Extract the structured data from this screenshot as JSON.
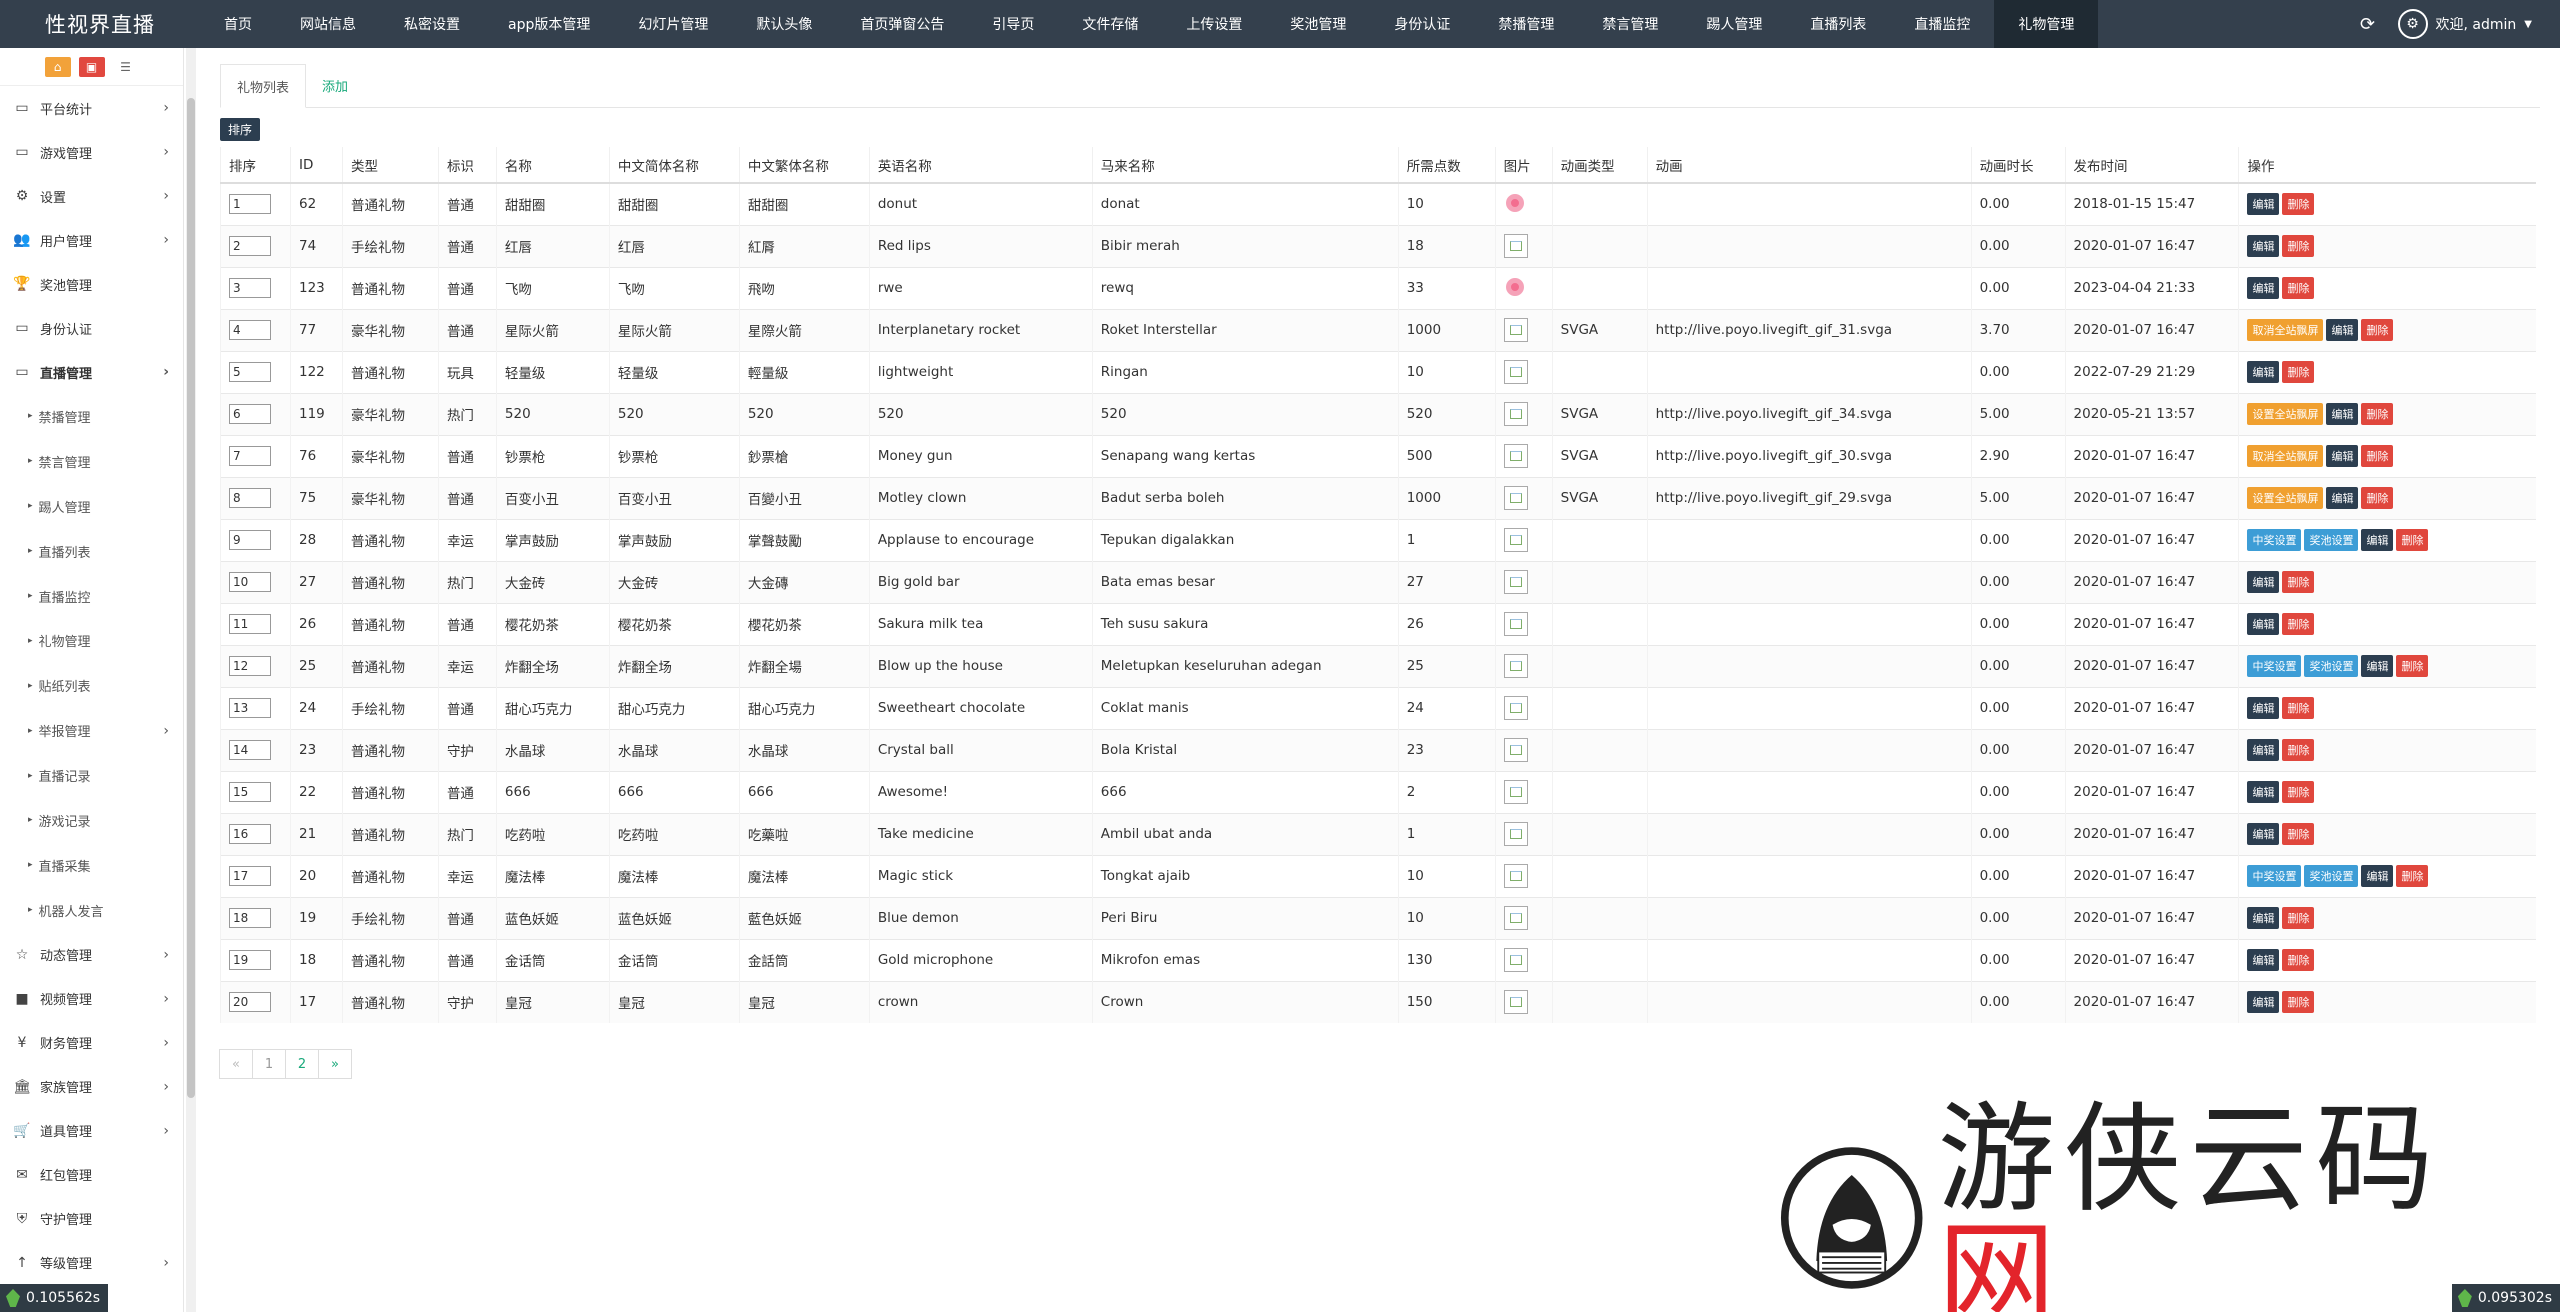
{
  "brand": "性视界直播",
  "nav": [
    "首页",
    "网站信息",
    "私密设置",
    "app版本管理",
    "幻灯片管理",
    "默认头像",
    "首页弹窗公告",
    "引导页",
    "文件存储",
    "上传设置",
    "奖池管理",
    "身份认证",
    "禁播管理",
    "禁言管理",
    "踢人管理",
    "直播列表",
    "直播监控",
    "礼物管理"
  ],
  "nav_active": "礼物管理",
  "user": {
    "greeting": "欢迎, admin"
  },
  "sidebar": {
    "top": [
      {
        "icon": "monitor-icon",
        "label": "平台统计",
        "arrow": true
      },
      {
        "icon": "monitor-icon",
        "label": "游戏管理",
        "arrow": true
      },
      {
        "icon": "gears-icon",
        "label": "设置",
        "arrow": true
      },
      {
        "icon": "users-icon",
        "label": "用户管理",
        "arrow": true
      },
      {
        "icon": "trophy-icon",
        "label": "奖池管理",
        "arrow": false
      },
      {
        "icon": "monitor-icon",
        "label": "身份认证",
        "arrow": false
      },
      {
        "icon": "monitor-icon",
        "label": "直播管理",
        "arrow": true,
        "open": true
      }
    ],
    "sub": [
      {
        "label": "禁播管理",
        "arrow": false
      },
      {
        "label": "禁言管理",
        "arrow": false
      },
      {
        "label": "踢人管理",
        "arrow": false
      },
      {
        "label": "直播列表",
        "arrow": false
      },
      {
        "label": "直播监控",
        "arrow": false
      },
      {
        "label": "礼物管理",
        "arrow": false
      },
      {
        "label": "贴纸列表",
        "arrow": false
      },
      {
        "label": "举报管理",
        "arrow": true
      },
      {
        "label": "直播记录",
        "arrow": false
      },
      {
        "label": "游戏记录",
        "arrow": false
      },
      {
        "label": "直播采集",
        "arrow": false
      },
      {
        "label": "机器人发言",
        "arrow": false
      }
    ],
    "bottom": [
      {
        "icon": "star-icon",
        "label": "动态管理",
        "arrow": true
      },
      {
        "icon": "video-icon",
        "label": "视频管理",
        "arrow": true
      },
      {
        "icon": "yen-icon",
        "label": "财务管理",
        "arrow": true
      },
      {
        "icon": "bank-icon",
        "label": "家族管理",
        "arrow": true
      },
      {
        "icon": "cart-icon",
        "label": "道具管理",
        "arrow": true
      },
      {
        "icon": "envelope-icon",
        "label": "红包管理",
        "arrow": false
      },
      {
        "icon": "shield-icon",
        "label": "守护管理",
        "arrow": false
      },
      {
        "icon": "level-icon",
        "label": "等级管理",
        "arrow": true
      }
    ]
  },
  "tabs": {
    "list": "礼物列表",
    "add": "添加"
  },
  "sort_button": "排序",
  "table": {
    "headers": [
      "排序",
      "ID",
      "类型",
      "标识",
      "名称",
      "中文简体名称",
      "中文繁体名称",
      "英语名称",
      "马来名称",
      "所需点数",
      "图片",
      "动画类型",
      "动画",
      "动画时长",
      "发布时间",
      "操作"
    ],
    "rows": [
      {
        "sort": "1",
        "id": "62",
        "type": "普通礼物",
        "mark": "普通",
        "name": "甜甜圈",
        "cn_s": "甜甜圈",
        "cn_t": "甜甜圈",
        "en": "donut",
        "ms": "donat",
        "points": "10",
        "img": "donut",
        "anim_type": "",
        "anim": "",
        "dur": "0.00",
        "time": "2018-01-15 15:47",
        "actions": [
          "编辑",
          "删除"
        ]
      },
      {
        "sort": "2",
        "id": "74",
        "type": "手绘礼物",
        "mark": "普通",
        "name": "红唇",
        "cn_s": "红唇",
        "cn_t": "紅脣",
        "en": "Red lips",
        "ms": "Bibir merah",
        "points": "18",
        "img": "ph",
        "anim_type": "",
        "anim": "",
        "dur": "0.00",
        "time": "2020-01-07 16:47",
        "actions": [
          "编辑",
          "删除"
        ]
      },
      {
        "sort": "3",
        "id": "123",
        "type": "普通礼物",
        "mark": "普通",
        "name": "飞吻",
        "cn_s": "飞吻",
        "cn_t": "飛吻",
        "en": "rwe",
        "ms": "rewq",
        "points": "33",
        "img": "donut",
        "anim_type": "",
        "anim": "",
        "dur": "0.00",
        "time": "2023-04-04 21:33",
        "actions": [
          "编辑",
          "删除"
        ]
      },
      {
        "sort": "4",
        "id": "77",
        "type": "豪华礼物",
        "mark": "普通",
        "name": "星际火箭",
        "cn_s": "星际火箭",
        "cn_t": "星際火箭",
        "en": "Interplanetary rocket",
        "ms": "Roket Interstellar",
        "points": "1000",
        "img": "ph",
        "anim_type": "SVGA",
        "anim": "http://live.poyo.livegift_gif_31.svga",
        "dur": "3.70",
        "time": "2020-01-07 16:47",
        "actions": [
          "取消全站飘屏",
          "编辑",
          "删除"
        ]
      },
      {
        "sort": "5",
        "id": "122",
        "type": "普通礼物",
        "mark": "玩具",
        "name": "轻量级",
        "cn_s": "轻量级",
        "cn_t": "輕量級",
        "en": "lightweight",
        "ms": "Ringan",
        "points": "10",
        "img": "ph",
        "anim_type": "",
        "anim": "",
        "dur": "0.00",
        "time": "2022-07-29 21:29",
        "actions": [
          "编辑",
          "删除"
        ]
      },
      {
        "sort": "6",
        "id": "119",
        "type": "豪华礼物",
        "mark": "热门",
        "name": "520",
        "cn_s": "520",
        "cn_t": "520",
        "en": "520",
        "ms": "520",
        "points": "520",
        "img": "ph",
        "anim_type": "SVGA",
        "anim": "http://live.poyo.livegift_gif_34.svga",
        "dur": "5.00",
        "time": "2020-05-21 13:57",
        "actions": [
          "设置全站飘屏",
          "编辑",
          "删除"
        ]
      },
      {
        "sort": "7",
        "id": "76",
        "type": "豪华礼物",
        "mark": "普通",
        "name": "钞票枪",
        "cn_s": "钞票枪",
        "cn_t": "鈔票槍",
        "en": "Money gun",
        "ms": "Senapang wang kertas",
        "points": "500",
        "img": "ph",
        "anim_type": "SVGA",
        "anim": "http://live.poyo.livegift_gif_30.svga",
        "dur": "2.90",
        "time": "2020-01-07 16:47",
        "actions": [
          "取消全站飘屏",
          "编辑",
          "删除"
        ]
      },
      {
        "sort": "8",
        "id": "75",
        "type": "豪华礼物",
        "mark": "普通",
        "name": "百变小丑",
        "cn_s": "百变小丑",
        "cn_t": "百變小丑",
        "en": "Motley clown",
        "ms": "Badut serba boleh",
        "points": "1000",
        "img": "ph",
        "anim_type": "SVGA",
        "anim": "http://live.poyo.livegift_gif_29.svga",
        "dur": "5.00",
        "time": "2020-01-07 16:47",
        "actions": [
          "设置全站飘屏",
          "编辑",
          "删除"
        ]
      },
      {
        "sort": "9",
        "id": "28",
        "type": "普通礼物",
        "mark": "幸运",
        "name": "掌声鼓励",
        "cn_s": "掌声鼓励",
        "cn_t": "掌聲鼓勵",
        "en": "Applause to encourage",
        "ms": "Tepukan digalakkan",
        "points": "1",
        "img": "ph",
        "anim_type": "",
        "anim": "",
        "dur": "0.00",
        "time": "2020-01-07 16:47",
        "actions": [
          "中奖设置",
          "奖池设置",
          "编辑",
          "删除"
        ]
      },
      {
        "sort": "10",
        "id": "27",
        "type": "普通礼物",
        "mark": "热门",
        "name": "大金砖",
        "cn_s": "大金砖",
        "cn_t": "大金磚",
        "en": "Big gold bar",
        "ms": "Bata emas besar",
        "points": "27",
        "img": "ph",
        "anim_type": "",
        "anim": "",
        "dur": "0.00",
        "time": "2020-01-07 16:47",
        "actions": [
          "编辑",
          "删除"
        ]
      },
      {
        "sort": "11",
        "id": "26",
        "type": "普通礼物",
        "mark": "普通",
        "name": "樱花奶茶",
        "cn_s": "樱花奶茶",
        "cn_t": "櫻花奶茶",
        "en": "Sakura milk tea",
        "ms": "Teh susu sakura",
        "points": "26",
        "img": "ph",
        "anim_type": "",
        "anim": "",
        "dur": "0.00",
        "time": "2020-01-07 16:47",
        "actions": [
          "编辑",
          "删除"
        ]
      },
      {
        "sort": "12",
        "id": "25",
        "type": "普通礼物",
        "mark": "幸运",
        "name": "炸翻全场",
        "cn_s": "炸翻全场",
        "cn_t": "炸翻全場",
        "en": "Blow up the house",
        "ms": "Meletupkan keseluruhan adegan",
        "points": "25",
        "img": "ph",
        "anim_type": "",
        "anim": "",
        "dur": "0.00",
        "time": "2020-01-07 16:47",
        "actions": [
          "中奖设置",
          "奖池设置",
          "编辑",
          "删除"
        ]
      },
      {
        "sort": "13",
        "id": "24",
        "type": "手绘礼物",
        "mark": "普通",
        "name": "甜心巧克力",
        "cn_s": "甜心巧克力",
        "cn_t": "甜心巧克力",
        "en": "Sweetheart chocolate",
        "ms": "Coklat manis",
        "points": "24",
        "img": "ph",
        "anim_type": "",
        "anim": "",
        "dur": "0.00",
        "time": "2020-01-07 16:47",
        "actions": [
          "编辑",
          "删除"
        ]
      },
      {
        "sort": "14",
        "id": "23",
        "type": "普通礼物",
        "mark": "守护",
        "name": "水晶球",
        "cn_s": "水晶球",
        "cn_t": "水晶球",
        "en": "Crystal ball",
        "ms": "Bola Kristal",
        "points": "23",
        "img": "ph",
        "anim_type": "",
        "anim": "",
        "dur": "0.00",
        "time": "2020-01-07 16:47",
        "actions": [
          "编辑",
          "删除"
        ]
      },
      {
        "sort": "15",
        "id": "22",
        "type": "普通礼物",
        "mark": "普通",
        "name": "666",
        "cn_s": "666",
        "cn_t": "666",
        "en": "Awesome!",
        "ms": "666",
        "points": "2",
        "img": "ph",
        "anim_type": "",
        "anim": "",
        "dur": "0.00",
        "time": "2020-01-07 16:47",
        "actions": [
          "编辑",
          "删除"
        ]
      },
      {
        "sort": "16",
        "id": "21",
        "type": "普通礼物",
        "mark": "热门",
        "name": "吃药啦",
        "cn_s": "吃药啦",
        "cn_t": "吃藥啦",
        "en": "Take medicine",
        "ms": "Ambil ubat anda",
        "points": "1",
        "img": "ph",
        "anim_type": "",
        "anim": "",
        "dur": "0.00",
        "time": "2020-01-07 16:47",
        "actions": [
          "编辑",
          "删除"
        ]
      },
      {
        "sort": "17",
        "id": "20",
        "type": "普通礼物",
        "mark": "幸运",
        "name": "魔法棒",
        "cn_s": "魔法棒",
        "cn_t": "魔法棒",
        "en": "Magic stick",
        "ms": "Tongkat ajaib",
        "points": "10",
        "img": "ph",
        "anim_type": "",
        "anim": "",
        "dur": "0.00",
        "time": "2020-01-07 16:47",
        "actions": [
          "中奖设置",
          "奖池设置",
          "编辑",
          "删除"
        ]
      },
      {
        "sort": "18",
        "id": "19",
        "type": "手绘礼物",
        "mark": "普通",
        "name": "蓝色妖姬",
        "cn_s": "蓝色妖姬",
        "cn_t": "藍色妖姬",
        "en": "Blue demon",
        "ms": "Peri Biru",
        "points": "10",
        "img": "ph",
        "anim_type": "",
        "anim": "",
        "dur": "0.00",
        "time": "2020-01-07 16:47",
        "actions": [
          "编辑",
          "删除"
        ]
      },
      {
        "sort": "19",
        "id": "18",
        "type": "普通礼物",
        "mark": "普通",
        "name": "金话筒",
        "cn_s": "金话筒",
        "cn_t": "金話筒",
        "en": "Gold microphone",
        "ms": "Mikrofon emas",
        "points": "130",
        "img": "ph",
        "anim_type": "",
        "anim": "",
        "dur": "0.00",
        "time": "2020-01-07 16:47",
        "actions": [
          "编辑",
          "删除"
        ]
      },
      {
        "sort": "20",
        "id": "17",
        "type": "普通礼物",
        "mark": "守护",
        "name": "皇冠",
        "cn_s": "皇冠",
        "cn_t": "皇冠",
        "en": "crown",
        "ms": "Crown",
        "points": "150",
        "img": "ph",
        "anim_type": "",
        "anim": "",
        "dur": "0.00",
        "time": "2020-01-07 16:47",
        "actions": [
          "编辑",
          "删除"
        ]
      }
    ]
  },
  "pager": [
    "«",
    "1",
    "2",
    "»"
  ],
  "watermark": {
    "text_a": "游侠云码",
    "text_b": "网"
  },
  "timing": {
    "left": "0.105562s",
    "right": "0.095302s"
  }
}
